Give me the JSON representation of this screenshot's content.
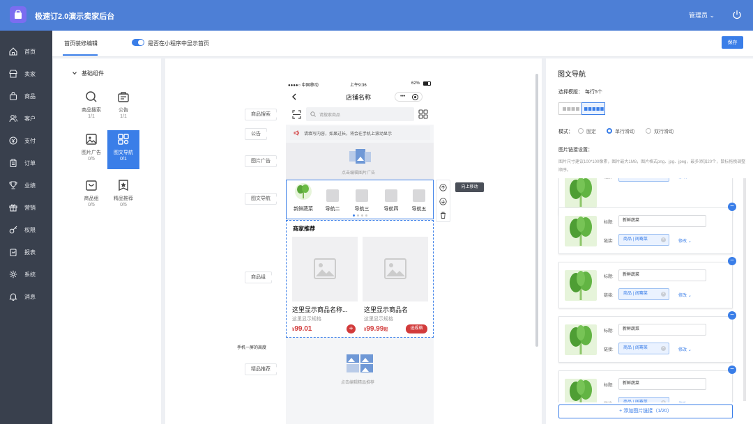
{
  "app": {
    "title": "极速订2.0演示卖家后台",
    "user": "管理员"
  },
  "sidebar": {
    "items": [
      {
        "label": "首页",
        "icon": "home-icon"
      },
      {
        "label": "卖家",
        "icon": "store-icon"
      },
      {
        "label": "商品",
        "icon": "bag-icon"
      },
      {
        "label": "客户",
        "icon": "users-icon"
      },
      {
        "label": "支付",
        "icon": "wallet-icon"
      },
      {
        "label": "订单",
        "icon": "clipboard-icon"
      },
      {
        "label": "业绩",
        "icon": "trophy-icon"
      },
      {
        "label": "营销",
        "icon": "gift-icon"
      },
      {
        "label": "权限",
        "icon": "key-icon"
      },
      {
        "label": "报表",
        "icon": "report-icon"
      },
      {
        "label": "系统",
        "icon": "gear-icon"
      },
      {
        "label": "消息",
        "icon": "bell-icon"
      }
    ]
  },
  "header": {
    "tab": "首页装修编辑",
    "toggle_label": "是否在小程序中显示首页",
    "save": "保存"
  },
  "components": {
    "group_title": "基础组件",
    "items": [
      {
        "label": "商品搜索",
        "count": "1/1",
        "icon": "search-icon"
      },
      {
        "label": "公告",
        "count": "1/1",
        "icon": "notice-icon"
      },
      {
        "label": "图片广告",
        "count": "0/5",
        "icon": "image-ad-icon"
      },
      {
        "label": "图文导航",
        "count": "0/1",
        "icon": "grid-nav-icon"
      },
      {
        "label": "商品组",
        "count": "0/5",
        "icon": "goods-group-icon"
      },
      {
        "label": "精品推荐",
        "count": "0/5",
        "icon": "recommend-icon"
      }
    ]
  },
  "phone": {
    "carrier": "●●●●○ 中国移动",
    "time": "上午9:36",
    "battery": "62%",
    "shop_name": "店铺名称",
    "search_placeholder": "请搜索商品",
    "notice": "请填写内容，如果过长，将会在手机上滚动显示",
    "ad_placeholder": "点击编辑图片广告",
    "nav_items": [
      "新鲜蔬菜",
      "导航二",
      "导航三",
      "导航四",
      "导航五"
    ],
    "goods_title": "商家推荐",
    "goods": [
      {
        "name": "这里显示商品名称...",
        "spec": "这里显示规格",
        "price": "99.01",
        "currency": "¥",
        "suffix": ""
      },
      {
        "name": "这里显示商品名",
        "spec": "这里显示规格",
        "price": "99.99",
        "currency": "¥",
        "suffix": "起",
        "button": "选规格"
      }
    ],
    "rec_placeholder": "点击编辑精品推荐"
  },
  "canvas_labels": {
    "search": "商品搜索",
    "notice": "公告",
    "ad": "图片广告",
    "nav": "图文导航",
    "goods": "商品组",
    "rec": "精品推荐",
    "screen_height": "手机一屏的高度",
    "move_up_tip": "向上移动"
  },
  "panel": {
    "title": "图文导航",
    "template_label": "选择模版：",
    "template_value": "每行5个",
    "mode_label": "模式：",
    "modes": [
      "固定",
      "单行滑动",
      "双行滑动"
    ],
    "mode_selected": "单行滑动",
    "link_settings": "图片链接设置：",
    "hint": "图片尺寸建议100*100像素，图片最大1M8，图片格式png、jpg、jpeg，最多添加20个，鼠标拖拽调整顺序。",
    "title_label": "标题:",
    "link_label": "链接:",
    "card_title": "新鲜蔬菜",
    "card_link": "商品 | 阔骞菜",
    "modify": "修改",
    "add_button": "+ 添加图片链接（1/20）"
  },
  "colors": {
    "primary": "#3a7ee8",
    "topbar": "#4d7fd6",
    "sidebar": "#39404d",
    "price": "#d23b3b"
  }
}
